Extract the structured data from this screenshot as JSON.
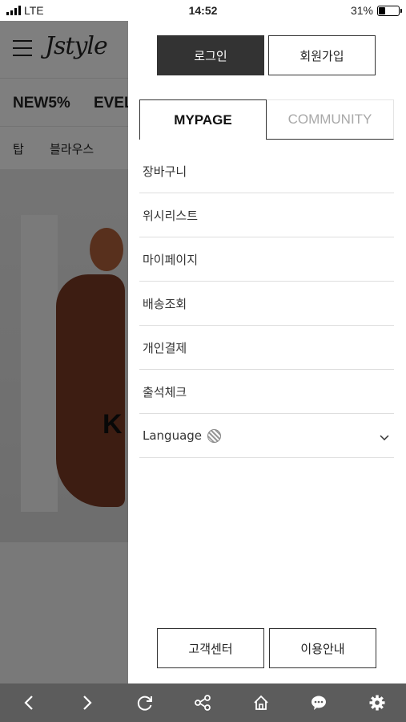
{
  "status_bar": {
    "carrier": "LTE",
    "time": "14:52",
    "battery": "31%",
    "battery_level": 0.31
  },
  "background_page": {
    "logo": "Jstyle",
    "categories": [
      "NEW5%",
      "EVEL"
    ],
    "subcategories": [
      "탑",
      "블라우스"
    ],
    "hero_text": "K"
  },
  "drawer": {
    "login_label": "로그인",
    "signup_label": "회원가입",
    "tabs": [
      {
        "label": "MYPAGE",
        "active": true
      },
      {
        "label": "COMMUNITY",
        "active": false
      }
    ],
    "menu_items": [
      {
        "label": "장바구니"
      },
      {
        "label": "위시리스트"
      },
      {
        "label": "마이페이지"
      },
      {
        "label": "배송조회"
      },
      {
        "label": "개인결제"
      },
      {
        "label": "출석체크"
      }
    ],
    "language": {
      "label": "Language",
      "icon": "globe-icon",
      "chevron": "chevron-down-icon"
    },
    "footer": {
      "customer_center_label": "고객센터",
      "guide_label": "이용안내"
    }
  },
  "toolbar": {
    "icons": [
      "back-icon",
      "forward-icon",
      "refresh-icon",
      "share-icon",
      "home-icon",
      "chat-icon",
      "settings-icon"
    ]
  },
  "colors": {
    "primary_dark": "#333333",
    "toolbar": "#5c5c5c",
    "inactive_tab": "#a8a8a8"
  }
}
